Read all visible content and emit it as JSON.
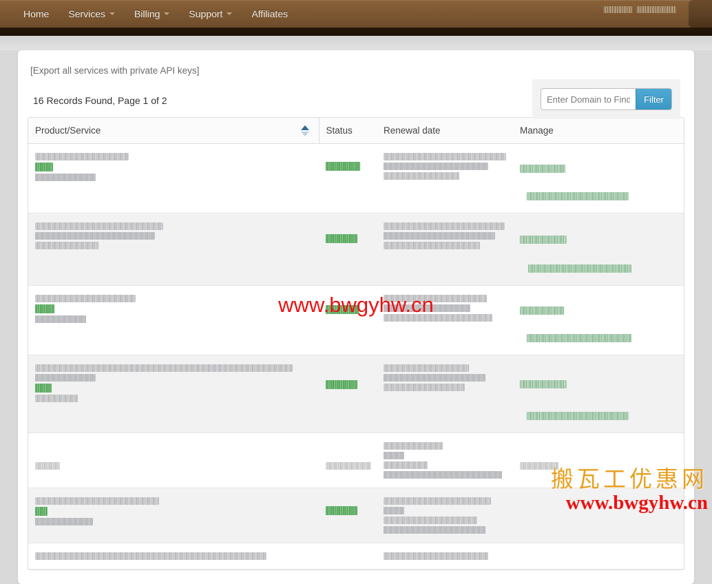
{
  "navbar": {
    "items": [
      {
        "label": "Home",
        "has_caret": false
      },
      {
        "label": "Services",
        "has_caret": true
      },
      {
        "label": "Billing",
        "has_caret": true
      },
      {
        "label": "Support",
        "has_caret": true
      },
      {
        "label": "Affiliates",
        "has_caret": false
      }
    ],
    "account_area_censored": true,
    "background_color": "#7d5832"
  },
  "content": {
    "export_link": "[Export all services with private API keys]",
    "records_summary": "16 Records Found, Page 1 of 2",
    "records_count": 16,
    "page_current": 1,
    "page_total": 2
  },
  "search": {
    "placeholder": "Enter Domain to Find",
    "value": "",
    "button_label": "Filter",
    "button_color": "#3a97c4"
  },
  "table": {
    "columns": [
      {
        "label": "Product/Service",
        "sortable": true,
        "sorted": "asc",
        "key": "product"
      },
      {
        "label": "Status",
        "sortable": false,
        "key": "status"
      },
      {
        "label": "Renewal date",
        "sortable": false,
        "key": "renewal"
      },
      {
        "label": "Manage",
        "sortable": false,
        "key": "manage"
      }
    ],
    "rows": [
      {
        "censored": true,
        "status_state": "active",
        "product_lines": 3,
        "renewal_lines": 3,
        "manage_links": 2
      },
      {
        "censored": true,
        "status_state": "active",
        "product_lines": 3,
        "renewal_lines": 3,
        "manage_links": 2
      },
      {
        "censored": true,
        "status_state": "active",
        "product_lines": 3,
        "renewal_lines": 3,
        "manage_links": 2
      },
      {
        "censored": true,
        "status_state": "active",
        "product_lines": 4,
        "renewal_lines": 3,
        "manage_links": 2
      },
      {
        "censored": true,
        "status_state": "inactive",
        "product_lines": 1,
        "renewal_lines": 4,
        "manage_links": 1
      },
      {
        "censored": true,
        "status_state": "active",
        "product_lines": 3,
        "renewal_lines": 4,
        "manage_links": 0
      },
      {
        "censored": true,
        "status_state": "none",
        "product_lines": 1,
        "renewal_lines": 1,
        "manage_links": 0
      }
    ]
  },
  "watermarks": {
    "center_url": "www.bwgyhw.cn",
    "corner_site_name": "搬瓦工优惠网",
    "corner_url": "www.bwgyhw.cn",
    "center_color": "#ee1111",
    "corner_name_color": "#e8a020"
  }
}
